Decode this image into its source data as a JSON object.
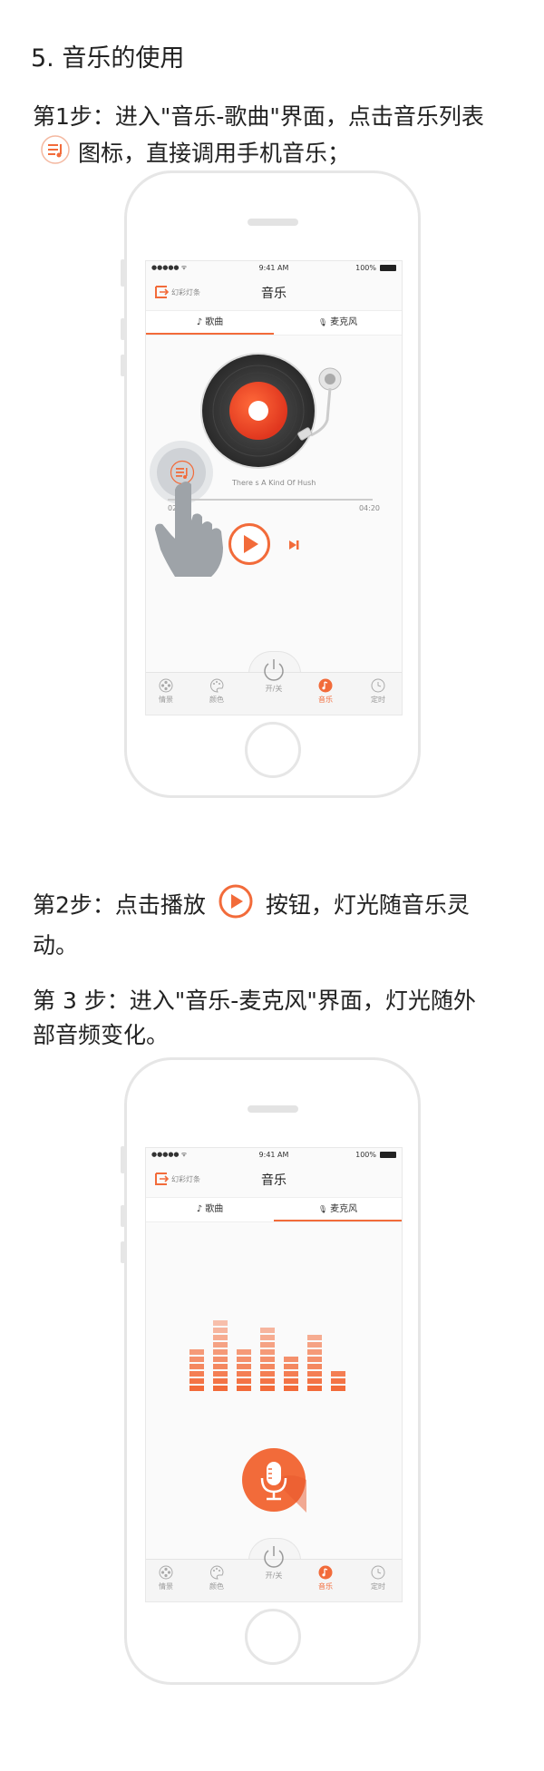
{
  "doc": {
    "heading": "5. 音乐的使用",
    "step1_a": "第1步：进入\"音乐-歌曲\"界面，点击音乐列表",
    "step1_b": "图标，直接调用手机音乐；",
    "step2_a": "第2步：点击播放",
    "step2_b": "按钮，灯光随音乐灵",
    "step2_c": "动。",
    "step3_a": "第 3 步：进入\"音乐-麦克风\"界面，灯光随外",
    "step3_b": "部音频变化。"
  },
  "phone1": {
    "status": {
      "signal": "●●●●● ᯤ",
      "time": "9:41 AM",
      "battery": "100%"
    },
    "brand": "幻彩灯条",
    "title": "音乐",
    "tabs": [
      {
        "icon": "♪",
        "label": "歌曲"
      },
      {
        "icon": "🎙",
        "label": "麦克风"
      }
    ],
    "song_title": "There s A Kind Of Hush",
    "time_start": "02",
    "time_end": "04:20",
    "tabbar": [
      {
        "label": "情景",
        "icon": "film-reel-icon"
      },
      {
        "label": "颜色",
        "icon": "palette-icon"
      },
      {
        "label": "开/关",
        "icon": "power-icon"
      },
      {
        "label": "音乐",
        "icon": "music-note-icon"
      },
      {
        "label": "定时",
        "icon": "clock-icon"
      }
    ]
  },
  "phone2": {
    "status": {
      "signal": "●●●●● ᯤ",
      "time": "9:41 AM",
      "battery": "100%"
    },
    "brand": "幻彩灯条",
    "title": "音乐",
    "tabs": [
      {
        "icon": "♪",
        "label": "歌曲"
      },
      {
        "icon": "🎙",
        "label": "麦克风"
      }
    ],
    "equalizer_levels": [
      6,
      10,
      6,
      9,
      5,
      8,
      3
    ],
    "tabbar": [
      {
        "label": "情景",
        "icon": "film-reel-icon"
      },
      {
        "label": "颜色",
        "icon": "palette-icon"
      },
      {
        "label": "开/关",
        "icon": "power-icon"
      },
      {
        "label": "音乐",
        "icon": "music-note-icon"
      },
      {
        "label": "定时",
        "icon": "clock-icon"
      }
    ]
  },
  "colors": {
    "accent": "#f26b3a",
    "text": "#222222",
    "frame": "#e6e6e6"
  }
}
